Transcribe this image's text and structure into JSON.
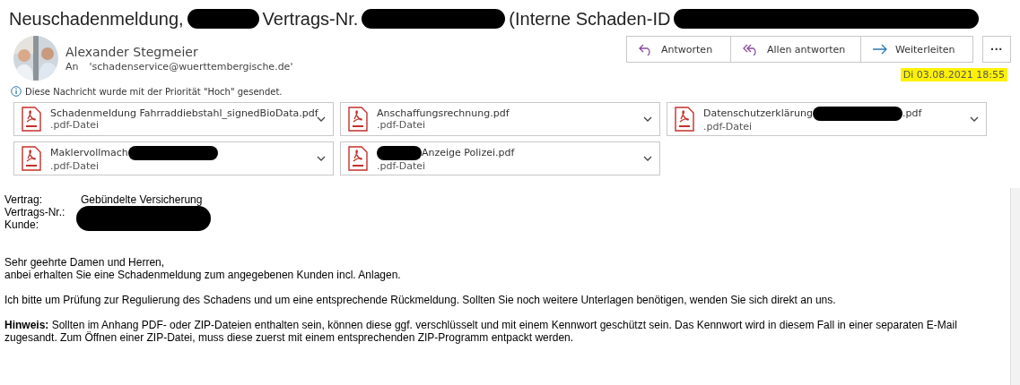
{
  "subject": [
    {
      "kind": "text",
      "text": "Neuschadenmeldung,"
    },
    {
      "kind": "redaction"
    },
    {
      "kind": "text",
      "text": "Vertrags-Nr."
    },
    {
      "kind": "redaction"
    },
    {
      "kind": "text",
      "text": "(Interne Schaden-ID"
    },
    {
      "kind": "redaction"
    }
  ],
  "sender": {
    "name": "Alexander Stegmeier",
    "to_label": "An",
    "to": "'schadenservice@wuerttembergische.de'"
  },
  "actions": [
    {
      "kind": "reply",
      "label": "Antworten"
    },
    {
      "kind": "reply-all",
      "label": "Allen antworten"
    },
    {
      "kind": "forward",
      "label": "Weiterleiten"
    }
  ],
  "more": "···",
  "date": {
    "text": "Di 03.08.2021 18:55",
    "highlighted": true
  },
  "priority_note": "Diese Nachricht wurde mit der Priorität \"Hoch\" gesendet.",
  "attachments": [
    {
      "name": [
        {
          "kind": "text",
          "text": "Schadenmeldung Fahrraddiebstahl_signedBioData.pdf"
        }
      ],
      "type": ".pdf-Datei"
    },
    {
      "name": [
        {
          "kind": "text",
          "text": "Anschaffungsrechnung.pdf"
        }
      ],
      "type": ".pdf-Datei"
    },
    {
      "name": [
        {
          "kind": "text",
          "text": "Datenschutzerklärung"
        },
        {
          "kind": "redaction"
        },
        {
          "kind": "text",
          "text": ".pdf"
        }
      ],
      "type": ".pdf-Datei"
    },
    {
      "name": [
        {
          "kind": "text",
          "text": "Maklervollmach"
        },
        {
          "kind": "redaction"
        }
      ],
      "type": ".pdf-Datei"
    },
    {
      "name": [
        {
          "kind": "redaction"
        },
        {
          "kind": "text",
          "text": "Anzeige Polizei.pdf"
        }
      ],
      "type": ".pdf-Datei"
    }
  ],
  "fields": [
    {
      "label": "Vertrag:",
      "value": "Gebündelte Versicherung",
      "redacted": false
    },
    {
      "label": "Vertrags-Nr.:",
      "redacted": true
    },
    {
      "label": "Kunde:",
      "redacted": true
    }
  ],
  "paragraphs": [
    [
      "Sehr geehrte Damen und Herren,",
      "anbei erhalten Sie eine Schadenmeldung zum angegebenen Kunden incl. Anlagen."
    ],
    [
      "Ich bitte um Prüfung zur Regulierung des Schadens und um eine entsprechende Rückmeldung. Sollten Sie noch weitere Unterlagen benötigen, wenden Sie sich direkt an uns."
    ],
    [
      "**Hinweis:** Sollten im Anhang PDF- oder ZIP-Dateien enthalten sein, können diese ggf. verschlüsselt und mit einem Kennwort geschützt sein. Das Kennwort wird in diesem Fall in einer separaten E-Mail zugesandt. Zum Öffnen einer ZIP-Datei, muss diese zuerst mit einem entsprechenden ZIP-Programm entpackt werden."
    ]
  ]
}
